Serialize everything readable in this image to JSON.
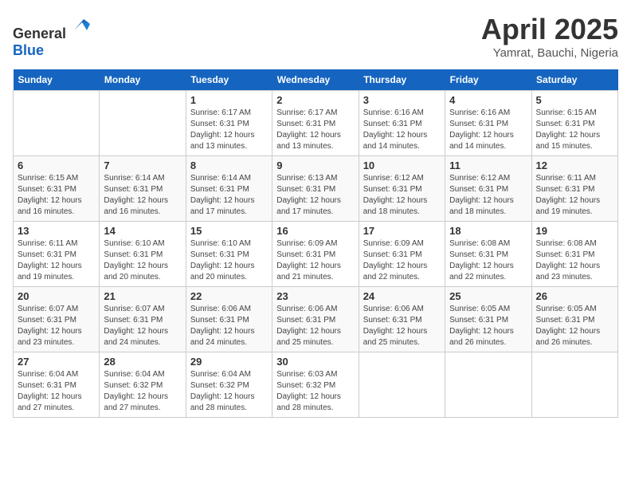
{
  "logo": {
    "general": "General",
    "blue": "Blue"
  },
  "title": "April 2025",
  "location": "Yamrat, Bauchi, Nigeria",
  "weekdays": [
    "Sunday",
    "Monday",
    "Tuesday",
    "Wednesday",
    "Thursday",
    "Friday",
    "Saturday"
  ],
  "weeks": [
    [
      {
        "day": "",
        "info": ""
      },
      {
        "day": "",
        "info": ""
      },
      {
        "day": "1",
        "info": "Sunrise: 6:17 AM\nSunset: 6:31 PM\nDaylight: 12 hours and 13 minutes."
      },
      {
        "day": "2",
        "info": "Sunrise: 6:17 AM\nSunset: 6:31 PM\nDaylight: 12 hours and 13 minutes."
      },
      {
        "day": "3",
        "info": "Sunrise: 6:16 AM\nSunset: 6:31 PM\nDaylight: 12 hours and 14 minutes."
      },
      {
        "day": "4",
        "info": "Sunrise: 6:16 AM\nSunset: 6:31 PM\nDaylight: 12 hours and 14 minutes."
      },
      {
        "day": "5",
        "info": "Sunrise: 6:15 AM\nSunset: 6:31 PM\nDaylight: 12 hours and 15 minutes."
      }
    ],
    [
      {
        "day": "6",
        "info": "Sunrise: 6:15 AM\nSunset: 6:31 PM\nDaylight: 12 hours and 16 minutes."
      },
      {
        "day": "7",
        "info": "Sunrise: 6:14 AM\nSunset: 6:31 PM\nDaylight: 12 hours and 16 minutes."
      },
      {
        "day": "8",
        "info": "Sunrise: 6:14 AM\nSunset: 6:31 PM\nDaylight: 12 hours and 17 minutes."
      },
      {
        "day": "9",
        "info": "Sunrise: 6:13 AM\nSunset: 6:31 PM\nDaylight: 12 hours and 17 minutes."
      },
      {
        "day": "10",
        "info": "Sunrise: 6:12 AM\nSunset: 6:31 PM\nDaylight: 12 hours and 18 minutes."
      },
      {
        "day": "11",
        "info": "Sunrise: 6:12 AM\nSunset: 6:31 PM\nDaylight: 12 hours and 18 minutes."
      },
      {
        "day": "12",
        "info": "Sunrise: 6:11 AM\nSunset: 6:31 PM\nDaylight: 12 hours and 19 minutes."
      }
    ],
    [
      {
        "day": "13",
        "info": "Sunrise: 6:11 AM\nSunset: 6:31 PM\nDaylight: 12 hours and 19 minutes."
      },
      {
        "day": "14",
        "info": "Sunrise: 6:10 AM\nSunset: 6:31 PM\nDaylight: 12 hours and 20 minutes."
      },
      {
        "day": "15",
        "info": "Sunrise: 6:10 AM\nSunset: 6:31 PM\nDaylight: 12 hours and 20 minutes."
      },
      {
        "day": "16",
        "info": "Sunrise: 6:09 AM\nSunset: 6:31 PM\nDaylight: 12 hours and 21 minutes."
      },
      {
        "day": "17",
        "info": "Sunrise: 6:09 AM\nSunset: 6:31 PM\nDaylight: 12 hours and 22 minutes."
      },
      {
        "day": "18",
        "info": "Sunrise: 6:08 AM\nSunset: 6:31 PM\nDaylight: 12 hours and 22 minutes."
      },
      {
        "day": "19",
        "info": "Sunrise: 6:08 AM\nSunset: 6:31 PM\nDaylight: 12 hours and 23 minutes."
      }
    ],
    [
      {
        "day": "20",
        "info": "Sunrise: 6:07 AM\nSunset: 6:31 PM\nDaylight: 12 hours and 23 minutes."
      },
      {
        "day": "21",
        "info": "Sunrise: 6:07 AM\nSunset: 6:31 PM\nDaylight: 12 hours and 24 minutes."
      },
      {
        "day": "22",
        "info": "Sunrise: 6:06 AM\nSunset: 6:31 PM\nDaylight: 12 hours and 24 minutes."
      },
      {
        "day": "23",
        "info": "Sunrise: 6:06 AM\nSunset: 6:31 PM\nDaylight: 12 hours and 25 minutes."
      },
      {
        "day": "24",
        "info": "Sunrise: 6:06 AM\nSunset: 6:31 PM\nDaylight: 12 hours and 25 minutes."
      },
      {
        "day": "25",
        "info": "Sunrise: 6:05 AM\nSunset: 6:31 PM\nDaylight: 12 hours and 26 minutes."
      },
      {
        "day": "26",
        "info": "Sunrise: 6:05 AM\nSunset: 6:31 PM\nDaylight: 12 hours and 26 minutes."
      }
    ],
    [
      {
        "day": "27",
        "info": "Sunrise: 6:04 AM\nSunset: 6:31 PM\nDaylight: 12 hours and 27 minutes."
      },
      {
        "day": "28",
        "info": "Sunrise: 6:04 AM\nSunset: 6:32 PM\nDaylight: 12 hours and 27 minutes."
      },
      {
        "day": "29",
        "info": "Sunrise: 6:04 AM\nSunset: 6:32 PM\nDaylight: 12 hours and 28 minutes."
      },
      {
        "day": "30",
        "info": "Sunrise: 6:03 AM\nSunset: 6:32 PM\nDaylight: 12 hours and 28 minutes."
      },
      {
        "day": "",
        "info": ""
      },
      {
        "day": "",
        "info": ""
      },
      {
        "day": "",
        "info": ""
      }
    ]
  ]
}
